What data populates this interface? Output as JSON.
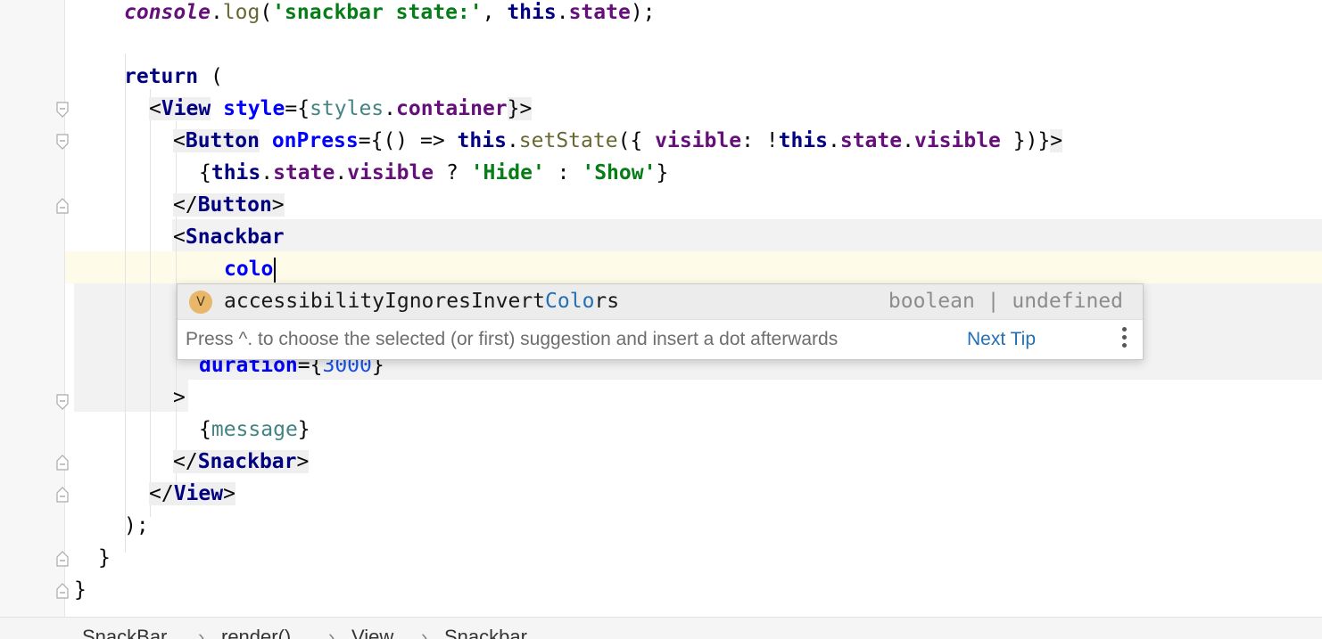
{
  "code": {
    "line1": {
      "global": "console",
      "dot": ".",
      "fn": "log",
      "open": "(",
      "str": "'snackbar state:'",
      "comma": ", ",
      "kw": "this",
      "dot2": ".",
      "prop": "state",
      "close": ");"
    },
    "line3": {
      "kw": "return",
      "rest": " ("
    },
    "line4": {
      "lt": "<",
      "tag": "View",
      "space": " ",
      "attr": "style",
      "eq": "={",
      "fld": "styles",
      "dot": ".",
      "prop": "container",
      "end": "}>"
    },
    "line5": {
      "lt": "<",
      "tag": "Button",
      "space": " ",
      "attr": "onPress",
      "eq": "={",
      "arrow": "() => ",
      "kw": "this",
      "dot": ".",
      "fn": "setState",
      "open": "({ ",
      "prop": "visible",
      "colon": ": !",
      "kw2": "this",
      "dot2": ".",
      "prop2": "state",
      "dot3": ".",
      "prop3": "visible",
      "close": " })}",
      "gt": ">"
    },
    "line6": {
      "open": "{",
      "kw": "this",
      "dot": ".",
      "prop": "state",
      "dot2": ".",
      "prop2": "visible",
      "q": " ? ",
      "str1": "'Hide'",
      "colon": " : ",
      "str2": "'Show'",
      "close": "}"
    },
    "line7": {
      "lt": "</",
      "tag": "Button",
      "gt": ">"
    },
    "line8": {
      "lt": "<",
      "tag": "Snackbar"
    },
    "line9": {
      "typed": "colo"
    },
    "line12": {
      "attr": "duration",
      "eq": "={",
      "num": "3000",
      "close": "}"
    },
    "line13": {
      "gt": ">"
    },
    "line14": {
      "open": "{",
      "fld": "message",
      "close": "}"
    },
    "line15": {
      "lt": "</",
      "tag": "Snackbar",
      "gt": ">"
    },
    "line16": {
      "lt": "</",
      "tag": "View",
      "gt": ">"
    },
    "line17": {
      "text": ");"
    },
    "line18": {
      "text": "}"
    },
    "line19": {
      "text": "}"
    }
  },
  "autocomplete": {
    "icon_letter": "V",
    "icon_name": "variable-icon",
    "suggestion_prefix": "accessibilityIgnoresInvert",
    "suggestion_match": "Colo",
    "suggestion_suffix": "rs",
    "type": "boolean | undefined",
    "hint": "Press ^. to choose the selected (or first) suggestion and insert a dot afterwards",
    "next_tip": "Next Tip"
  },
  "breadcrumbs": [
    "SnackBar",
    "render()",
    "View",
    "Snackbar"
  ],
  "colors": {
    "keyword": "#000080",
    "attribute": "#0000ff",
    "property": "#660e7a",
    "string": "#067d17",
    "number": "#1750eb",
    "current_line": "#fefbe8",
    "selection_highlight": "#efefef"
  }
}
